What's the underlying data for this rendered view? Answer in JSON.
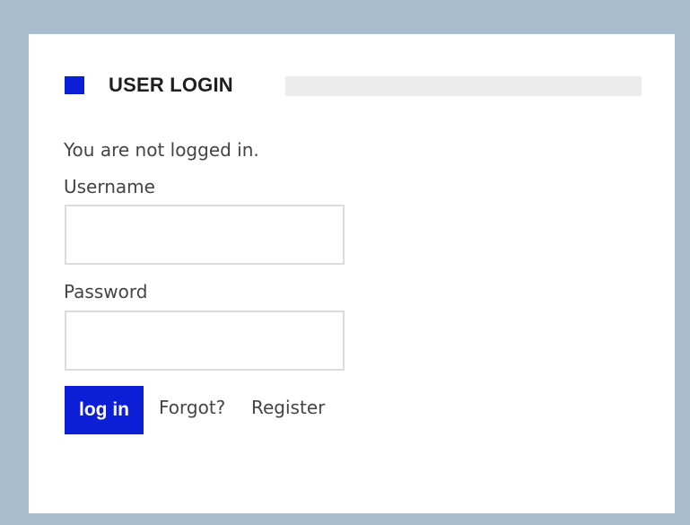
{
  "colors": {
    "page_background": "#a9bdcf",
    "panel_background": "#ffffff",
    "accent": "#0c1fd6",
    "header_bar": "#ececec"
  },
  "login_block": {
    "title": "USER LOGIN",
    "status": "You are not logged in.",
    "username_label": "Username",
    "username_value": "",
    "password_label": "Password",
    "password_value": "",
    "login_button_label": "log in",
    "forgot_link_label": "Forgot?",
    "register_link_label": "Register"
  }
}
